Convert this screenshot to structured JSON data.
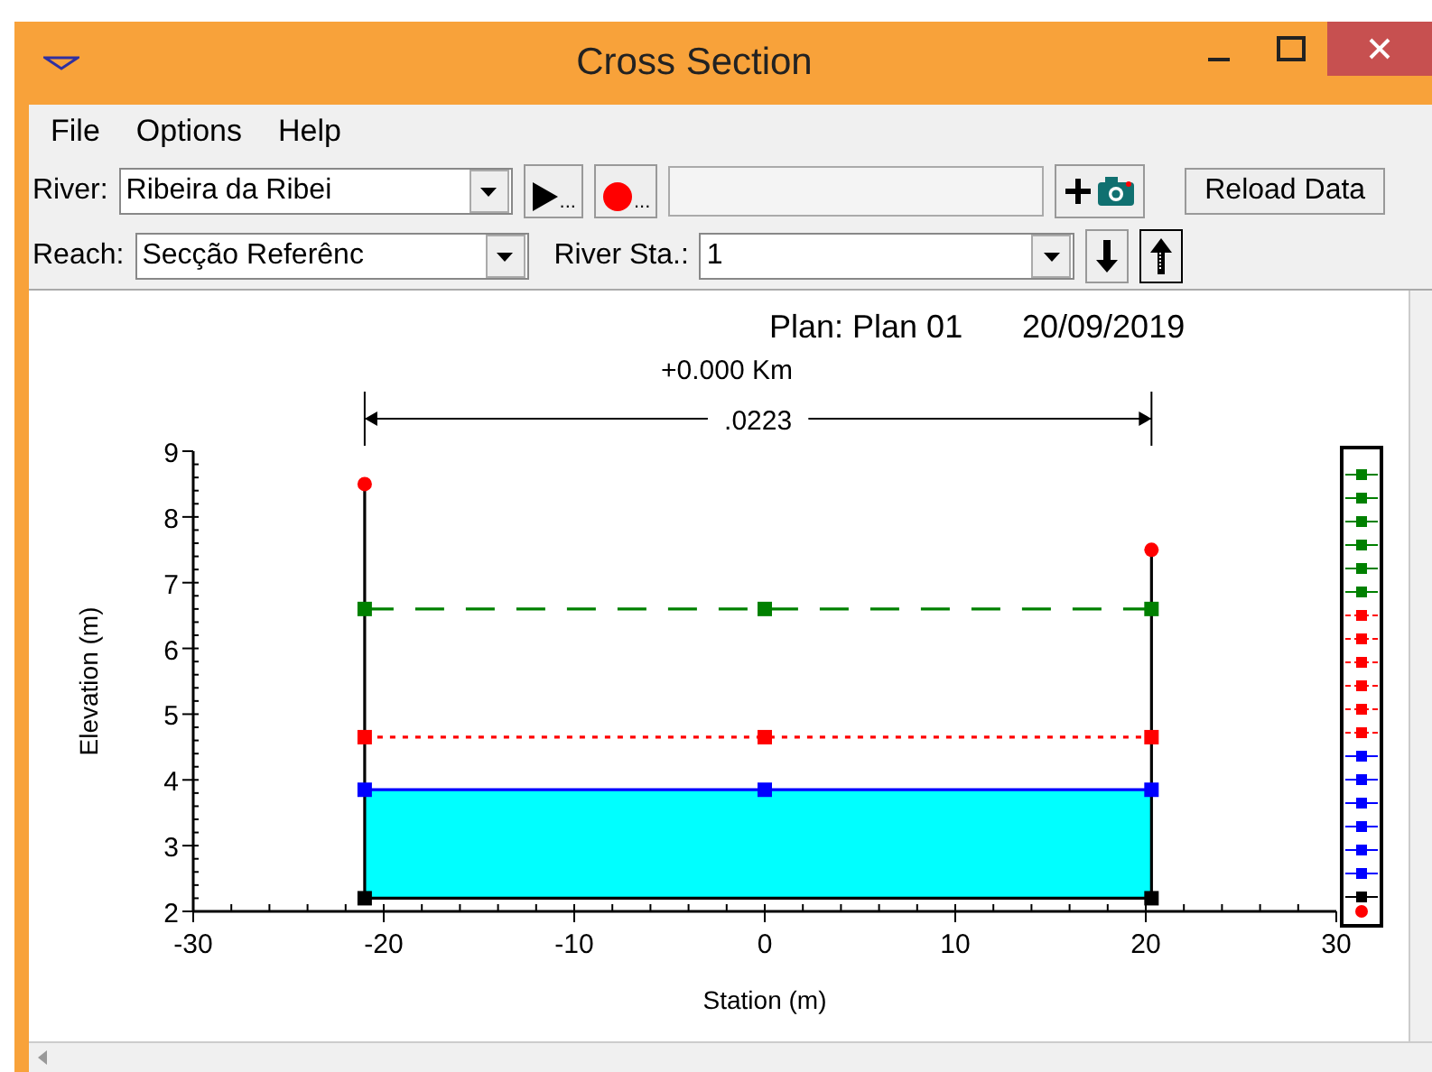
{
  "window": {
    "title": "Cross Section"
  },
  "menu": [
    "File",
    "Options",
    "Help"
  ],
  "toolbar": {
    "river_label": "River:",
    "river": "Ribeira da Ribei",
    "reach_label": "Reach:",
    "reach": "Secção Referênc",
    "river_sta_label": "River Sta.:",
    "river_sta": "1",
    "animate_suffix": "...",
    "profile_suffix": "...",
    "reload_button": "Reload Data"
  },
  "plot": {
    "title": "Plan: Plan 01",
    "date": "20/09/2019",
    "station_label": "+0.000 Km",
    "reach_length": ".0223",
    "chart_data": {
      "type": "line",
      "xlabel": "Station (m)",
      "ylabel": "Elevation (m)",
      "x": [
        -21,
        -21,
        0,
        20.3,
        20.3
      ],
      "xlim": [
        -30,
        30
      ],
      "ylim": [
        2,
        9
      ],
      "xticks": [
        -30,
        -20,
        -10,
        0,
        10,
        20,
        30
      ],
      "yticks": [
        2,
        3,
        4,
        5,
        6,
        7,
        8,
        9
      ],
      "series": [
        {
          "color": "#000000",
          "line_style": "solid",
          "marker": "circle",
          "values": [
            8.5,
            2.2,
            2.2,
            2.2,
            7.5
          ]
        },
        {
          "color": "#0000ff",
          "line_style": "solid",
          "marker": "square",
          "values": [
            null,
            3.85,
            3.85,
            3.85,
            null
          ]
        },
        {
          "color": "#ff0000",
          "line_style": "dotted",
          "marker": "square",
          "values": [
            null,
            4.65,
            4.65,
            4.65,
            null
          ]
        },
        {
          "color": "#008000",
          "line_style": "dashed",
          "marker": "square",
          "values": [
            null,
            6.6,
            6.6,
            6.6,
            null
          ]
        }
      ]
    }
  }
}
